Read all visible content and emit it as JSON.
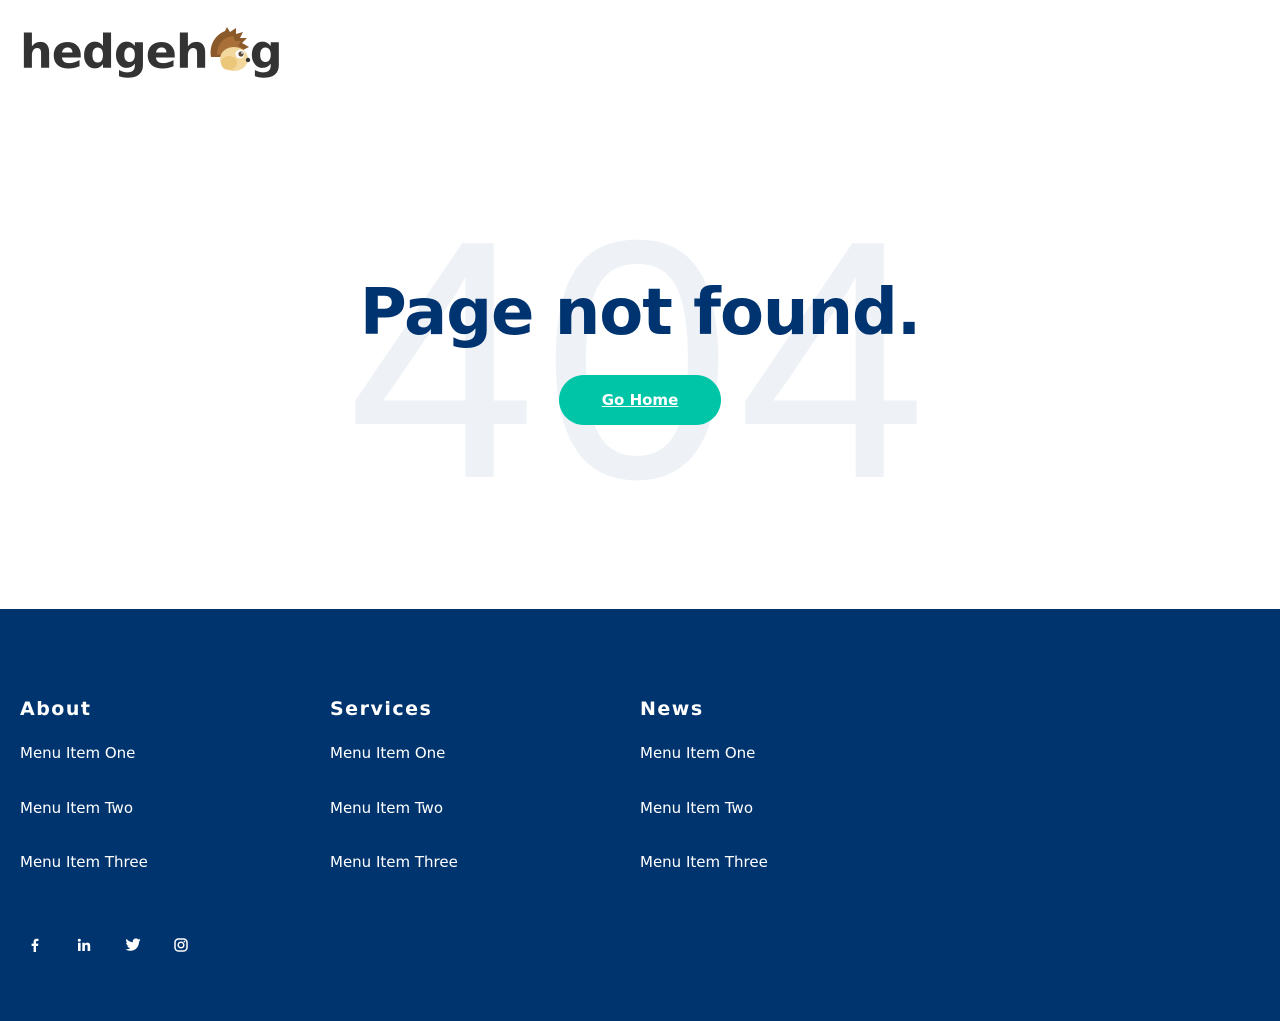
{
  "header": {
    "logo": {
      "text_left": "hedgeh",
      "text_right": "g"
    }
  },
  "main": {
    "background_code": "404",
    "title": "Page not found.",
    "button_label": "Go Home"
  },
  "footer": {
    "columns": [
      {
        "heading": "About",
        "items": [
          "Menu Item One",
          "Menu Item Two",
          "Menu Item Three"
        ]
      },
      {
        "heading": "Services",
        "items": [
          "Menu Item One",
          "Menu Item Two",
          "Menu Item Three"
        ]
      },
      {
        "heading": "News",
        "items": [
          "Menu Item One",
          "Menu Item Two",
          "Menu Item Three"
        ]
      }
    ],
    "social": [
      {
        "icon": "facebook-icon"
      },
      {
        "icon": "linkedin-icon"
      },
      {
        "icon": "twitter-icon"
      },
      {
        "icon": "instagram-icon"
      }
    ]
  },
  "colors": {
    "navy": "#00346e",
    "title": "#003470",
    "accent": "#00c5a7",
    "watermark": "#eef2f7",
    "logo_text": "#333333"
  }
}
